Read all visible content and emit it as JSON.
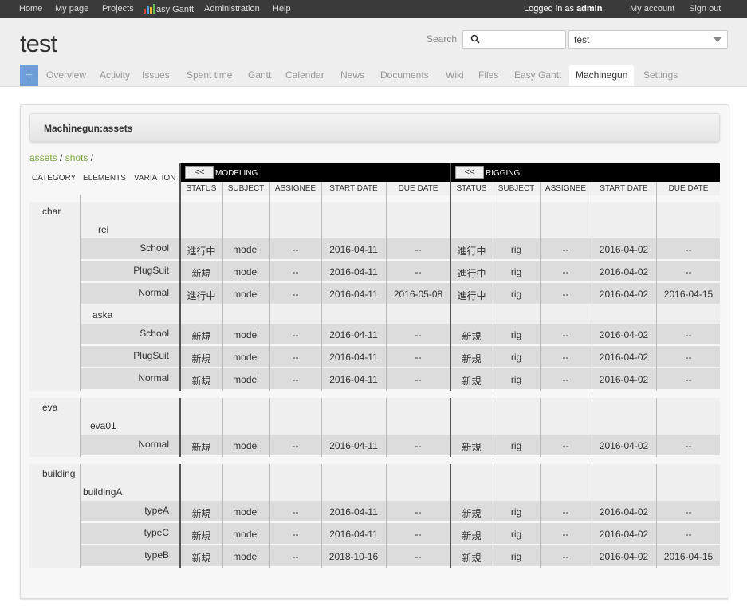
{
  "top_menu": {
    "home": "Home",
    "my_page": "My page",
    "projects": "Projects",
    "easy_gantt_logo_text": "E",
    "easy_gantt": "asy Gantt",
    "administration": "Administration",
    "help": "Help",
    "logged_in_prefix": "Logged in as",
    "user": "admin",
    "my_account": "My account",
    "sign_out": "Sign out"
  },
  "header": {
    "project_title": "test",
    "search_label": "Search",
    "search_placeholder": "",
    "project_select_value": "test"
  },
  "tabs": [
    {
      "label": "Overview"
    },
    {
      "label": "Activity"
    },
    {
      "label": "Issues"
    },
    {
      "label": "Spent time"
    },
    {
      "label": "Gantt"
    },
    {
      "label": "Calendar"
    },
    {
      "label": "News"
    },
    {
      "label": "Documents"
    },
    {
      "label": "Wiki"
    },
    {
      "label": "Files"
    },
    {
      "label": "Easy Gantt"
    },
    {
      "label": "Machinegun"
    },
    {
      "label": "Settings"
    }
  ],
  "add_button": "+",
  "page": {
    "title": "Machinegun:assets",
    "breadcrumb": {
      "assets": "assets",
      "sep": "/",
      "shots": "shots",
      "sep2": "/"
    }
  },
  "grid": {
    "left_headers": {
      "category": "CATEGORY",
      "elements": "ELEMENTS",
      "variation": "VARIATION"
    },
    "back_label": "<<",
    "sections": [
      {
        "title": "MODELING"
      },
      {
        "title": "RIGGING"
      }
    ],
    "columns": [
      "STATUS",
      "SUBJECT",
      "ASSIGNEE",
      "START DATE",
      "DUE DATE"
    ],
    "categories": [
      {
        "name": "char",
        "elements": [
          {
            "name": "rei",
            "variations": [
              {
                "name": "School",
                "modeling": [
                  "進行中",
                  "model",
                  "--",
                  "2016-04-11",
                  "--"
                ],
                "rigging": [
                  "進行中",
                  "rig",
                  "--",
                  "2016-04-02",
                  "--"
                ]
              },
              {
                "name": "PlugSuit",
                "modeling": [
                  "新規",
                  "model",
                  "--",
                  "2016-04-11",
                  "--"
                ],
                "rigging": [
                  "進行中",
                  "rig",
                  "--",
                  "2016-04-02",
                  "--"
                ]
              },
              {
                "name": "Normal",
                "modeling": [
                  "進行中",
                  "model",
                  "--",
                  "2016-04-11",
                  "2016-05-08"
                ],
                "rigging": [
                  "進行中",
                  "rig",
                  "--",
                  "2016-04-02",
                  "2016-04-15"
                ]
              }
            ]
          },
          {
            "name": "aska",
            "variations": [
              {
                "name": "School",
                "modeling": [
                  "新規",
                  "model",
                  "--",
                  "2016-04-11",
                  "--"
                ],
                "rigging": [
                  "新規",
                  "rig",
                  "--",
                  "2016-04-02",
                  "--"
                ]
              },
              {
                "name": "PlugSuit",
                "modeling": [
                  "新規",
                  "model",
                  "--",
                  "2016-04-11",
                  "--"
                ],
                "rigging": [
                  "新規",
                  "rig",
                  "--",
                  "2016-04-02",
                  "--"
                ]
              },
              {
                "name": "Normal",
                "modeling": [
                  "新規",
                  "model",
                  "--",
                  "2016-04-11",
                  "--"
                ],
                "rigging": [
                  "新規",
                  "rig",
                  "--",
                  "2016-04-02",
                  "--"
                ]
              }
            ]
          }
        ]
      },
      {
        "name": "eva",
        "elements": [
          {
            "name": "eva01",
            "variations": [
              {
                "name": "Normal",
                "modeling": [
                  "新規",
                  "model",
                  "--",
                  "2016-04-11",
                  "--"
                ],
                "rigging": [
                  "新規",
                  "rig",
                  "--",
                  "2016-04-02",
                  "--"
                ]
              }
            ]
          }
        ]
      },
      {
        "name": "building",
        "elements": [
          {
            "name": "buildingA",
            "variations": [
              {
                "name": "typeA",
                "modeling": [
                  "新規",
                  "model",
                  "--",
                  "2016-04-11",
                  "--"
                ],
                "rigging": [
                  "新規",
                  "rig",
                  "--",
                  "2016-04-02",
                  "--"
                ]
              },
              {
                "name": "typeC",
                "modeling": [
                  "新規",
                  "model",
                  "--",
                  "2016-04-11",
                  "--"
                ],
                "rigging": [
                  "新規",
                  "rig",
                  "--",
                  "2016-04-02",
                  "--"
                ]
              },
              {
                "name": "typeB",
                "modeling": [
                  "新規",
                  "model",
                  "--",
                  "2018-10-16",
                  "--"
                ],
                "rigging": [
                  "新規",
                  "rig",
                  "--",
                  "2016-04-02",
                  "2016-04-15"
                ]
              }
            ]
          }
        ]
      }
    ]
  }
}
